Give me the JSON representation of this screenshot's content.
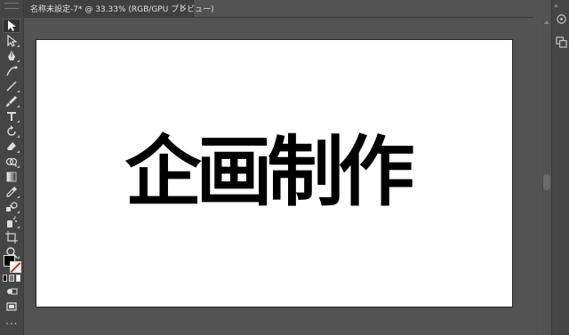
{
  "document": {
    "tab_title": "名称未設定-7* @ 33.33% (RGB/GPU プレビュー)",
    "close_glyph": "×"
  },
  "artboard": {
    "text": "企画制作",
    "text_color": "#000000",
    "background": "#ffffff"
  },
  "toolbar": {
    "tools": [
      "selection-tool",
      "direct-selection-tool",
      "pen-tool",
      "curvature-tool",
      "line-tool",
      "paintbrush-tool",
      "type-tool",
      "rotate-tool",
      "eraser-tool",
      "shape-builder-tool",
      "gradient-tool",
      "eyedropper-tool",
      "blend-tool",
      "symbol-sprayer-tool",
      "artboard-tool",
      "zoom-tool"
    ],
    "fill_color": "#000000",
    "stroke_color": "none",
    "more_label": "..."
  },
  "colors": {
    "app_background": "#535353",
    "panel_background": "#454545"
  }
}
